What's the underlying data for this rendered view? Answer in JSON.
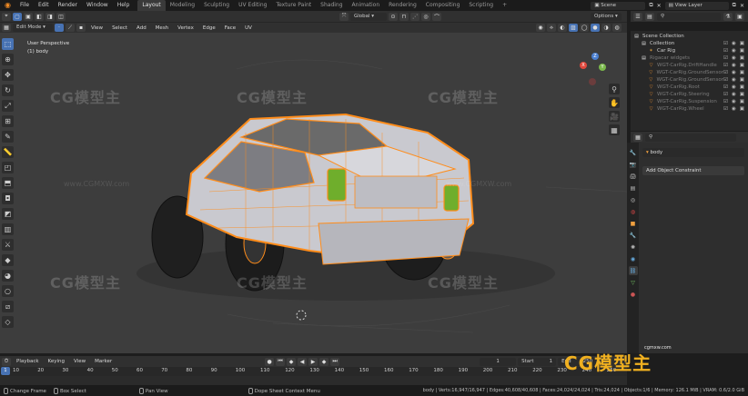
{
  "top_menu": [
    "File",
    "Edit",
    "Render",
    "Window",
    "Help"
  ],
  "workspaces": [
    "Layout",
    "Modeling",
    "Sculpting",
    "UV Editing",
    "Texture Paint",
    "Shading",
    "Animation",
    "Rendering",
    "Compositing",
    "Scripting"
  ],
  "scene_label": "Scene",
  "view_layer_label": "View Layer",
  "viewport": {
    "mode": "Edit Mode",
    "menus": [
      "View",
      "Select",
      "Add",
      "Mesh",
      "Vertex",
      "Edge",
      "Face",
      "UV"
    ],
    "transform_orientation": "Global",
    "options_label": "Options",
    "view_name": "User Perspective",
    "object_line": "(1) body",
    "gizmo_axes": [
      "X",
      "Y",
      "Z"
    ]
  },
  "watermark": {
    "text": "CG模型主",
    "url": "www.CGMXW.com",
    "corner_url": "cgmxw.com"
  },
  "outliner": {
    "rows": [
      {
        "label": "Scene Collection",
        "indent": 0,
        "icon": "collection-icon",
        "state": "normal"
      },
      {
        "label": "Collection",
        "indent": 1,
        "icon": "collection-icon",
        "state": "normal"
      },
      {
        "label": "Car Rig",
        "indent": 2,
        "icon": "armature-icon",
        "state": "normal"
      },
      {
        "label": "Rigacar widgets",
        "indent": 1,
        "icon": "collection-icon",
        "state": "dim"
      },
      {
        "label": "WGT-CarRig.DriftHandle",
        "indent": 2,
        "icon": "mesh-icon",
        "state": "dim"
      },
      {
        "label": "WGT-CarRig.GroundSensor",
        "indent": 2,
        "icon": "mesh-icon",
        "state": "dim"
      },
      {
        "label": "WGT-CarRig.GroundSensor",
        "indent": 2,
        "icon": "mesh-icon",
        "state": "dim"
      },
      {
        "label": "WGT-CarRig.Root",
        "indent": 2,
        "icon": "mesh-icon",
        "state": "dim"
      },
      {
        "label": "WGT-CarRig.Steering",
        "indent": 2,
        "icon": "mesh-icon",
        "state": "dim"
      },
      {
        "label": "WGT-CarRig.Suspension",
        "indent": 2,
        "icon": "mesh-icon",
        "state": "dim"
      },
      {
        "label": "WGT-CarRig.Wheel",
        "indent": 2,
        "icon": "mesh-icon",
        "state": "dim"
      }
    ]
  },
  "properties": {
    "object_name": "body",
    "add_constraint_label": "Add Object Constraint",
    "tab_icons": [
      "tool-icon",
      "render-icon",
      "output-icon",
      "view-layer-icon",
      "scene-icon",
      "world-icon",
      "object-icon",
      "modifier-icon",
      "particles-icon",
      "physics-icon",
      "constraint-icon",
      "data-icon",
      "material-icon"
    ]
  },
  "timeline": {
    "menus": [
      "Playback",
      "Keying",
      "View",
      "Marker"
    ],
    "current_frame": "1",
    "start_label": "Start",
    "start_value": "1",
    "end_label": "End",
    "end_value": "250",
    "ruler_ticks": [
      "10",
      "20",
      "30",
      "40",
      "50",
      "60",
      "70",
      "80",
      "90",
      "100",
      "110",
      "120",
      "130",
      "140",
      "150",
      "160",
      "170",
      "180",
      "190",
      "200",
      "210",
      "220",
      "230",
      "240",
      "250"
    ]
  },
  "status_bar": {
    "items": [
      "Change Frame",
      "Box Select",
      "Pan View",
      "Dope Sheet Context Menu"
    ],
    "stats": "body | Verts:16,947/16,947 | Edges:40,608/40,608 | Faces:24,024/24,024 | Tris:24,024 | Objects:1/6 | Memory: 126.1 MiB | VRAM: 0.6/2.0 GiB"
  },
  "colors": {
    "accent": "#4772b3",
    "selection_orange": "#ff8c1a",
    "viewport_bg": "#3d3d3d"
  }
}
